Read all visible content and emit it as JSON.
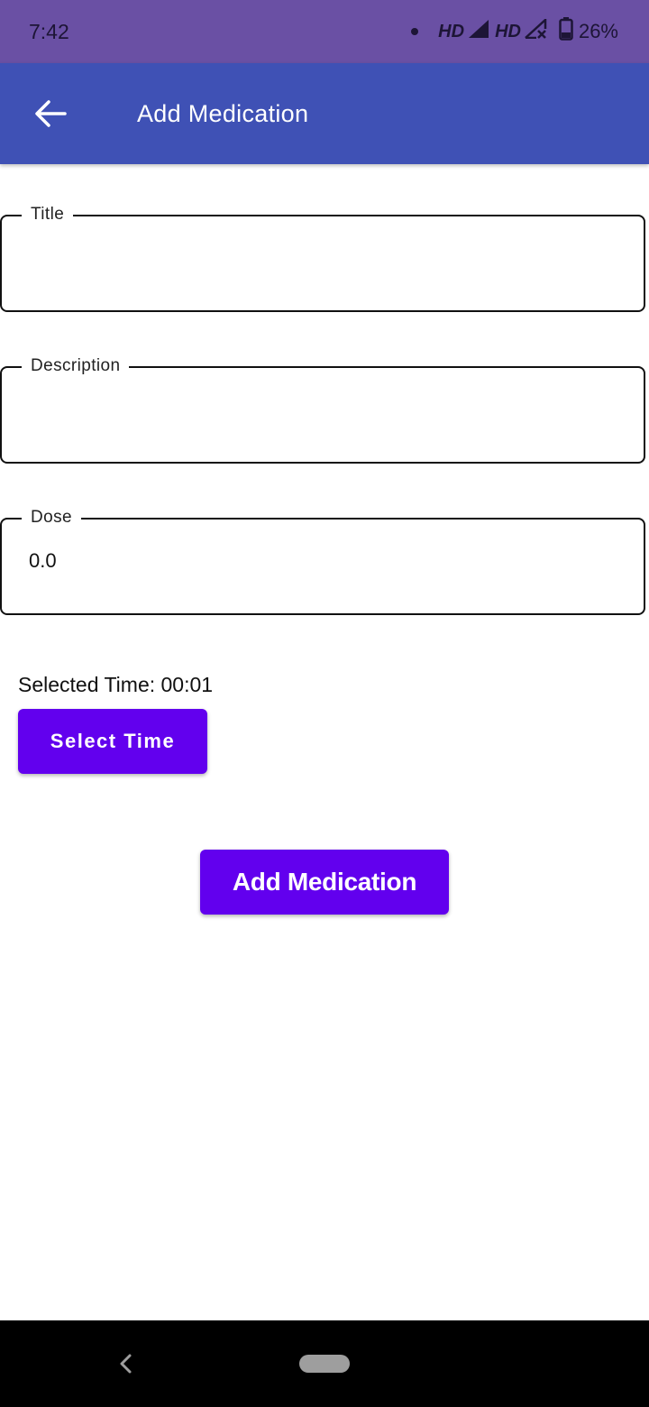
{
  "status_bar": {
    "time": "7:42",
    "network_1": "HD",
    "network_2": "HD",
    "battery": "26%",
    "icons": [
      "notification-dot-icon",
      "signal-icon",
      "signal-no-service-icon",
      "battery-icon"
    ]
  },
  "app_bar": {
    "title": "Add Medication",
    "back_icon": "arrow-back-icon",
    "background": "#3f51b5"
  },
  "form": {
    "title": {
      "label": "Title",
      "value": ""
    },
    "description": {
      "label": "Description",
      "value": ""
    },
    "dose": {
      "label": "Dose",
      "value": "0.0"
    }
  },
  "selected_time": "Selected Time: 00:01",
  "buttons": {
    "select_time": "Select Time",
    "add_medication": "Add Medication",
    "color": "#6200ee"
  },
  "nav_bar": {
    "back_icon": "nav-back-icon",
    "home_icon": "nav-home-pill-icon"
  }
}
